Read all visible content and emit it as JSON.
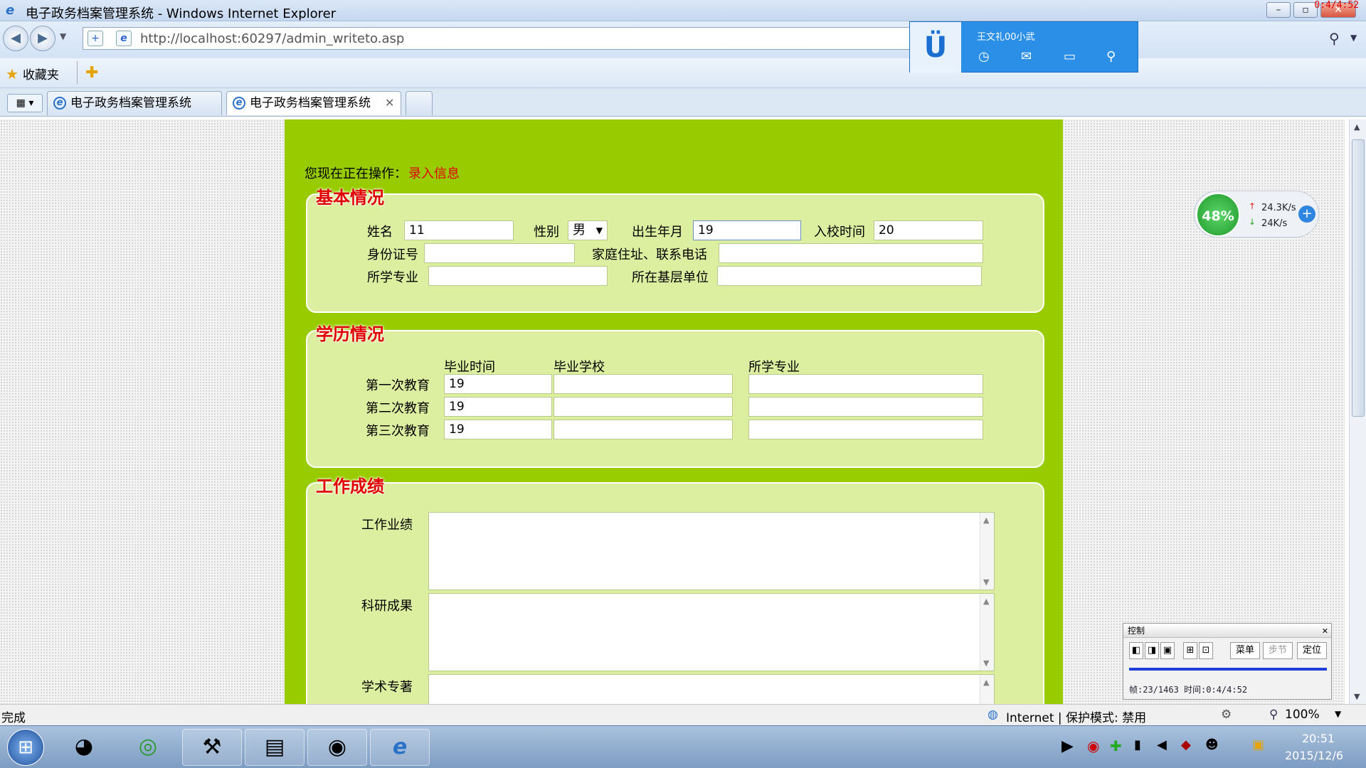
{
  "window": {
    "title": "电子政务档案管理系统 - Windows Internet Explorer",
    "time_counter": "0:4/4:52"
  },
  "address": {
    "url": "http://localhost:60297/admin_writeto.asp"
  },
  "favorites": {
    "label": "收藏夹"
  },
  "tabs": [
    {
      "label": "电子政务档案管理系统"
    },
    {
      "label": "电子政务档案管理系统"
    }
  ],
  "qq": {
    "name": "王文礼00小武"
  },
  "speed": {
    "percent": "48%",
    "up": "24.3K/s",
    "down": "24K/s"
  },
  "page": {
    "operation_label": "您现在正在操作：",
    "operation_value": "录入信息",
    "basic": {
      "legend": "基本情况",
      "name_label": "姓名",
      "name_value": "11",
      "gender_label": "性别",
      "gender_value": "男",
      "birth_label": "出生年月",
      "birth_value": "19",
      "enroll_label": "入校时间",
      "enroll_value": "20",
      "id_label": "身份证号",
      "id_value": "",
      "address_label": "家庭住址、联系电话",
      "address_value": "",
      "major_label": "所学专业",
      "major_value": "",
      "unit_label": "所在基层单位",
      "unit_value": ""
    },
    "education": {
      "legend": "学历情况",
      "headers": [
        "毕业时间",
        "毕业学校",
        "所学专业"
      ],
      "rows": [
        {
          "label": "第一次教育",
          "time": "19",
          "school": "",
          "major": ""
        },
        {
          "label": "第二次教育",
          "time": "19",
          "school": "",
          "major": ""
        },
        {
          "label": "第三次教育",
          "time": "19",
          "school": "",
          "major": ""
        }
      ]
    },
    "work": {
      "legend": "工作成绩",
      "achievement_label": "工作业绩",
      "research_label": "科研成果",
      "books_label": "学术专著"
    }
  },
  "statusbar": {
    "status": "完成",
    "zone": "Internet | 保护模式: 禁用",
    "zoom": "100%"
  },
  "control": {
    "title": "控制",
    "menu_label": "菜单",
    "step_label": "步节",
    "locate_label": "定位",
    "info": "帧:23/1463 时间:0:4/4:52"
  },
  "clock": {
    "time": "20:51",
    "date": "2015/12/6"
  }
}
